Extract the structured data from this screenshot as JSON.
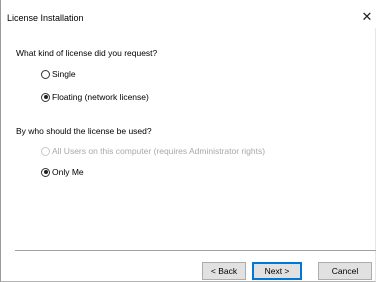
{
  "window": {
    "title": "License Installation",
    "close_glyph": "✕"
  },
  "license_type": {
    "question": "What kind of license did you request?",
    "options": [
      {
        "label": "Single",
        "selected": false,
        "enabled": true
      },
      {
        "label": "Floating (network license)",
        "selected": true,
        "enabled": true
      }
    ]
  },
  "license_scope": {
    "question": "By who should the license be used?",
    "options": [
      {
        "label": "All Users on this computer (requires Administrator rights)",
        "selected": false,
        "enabled": false
      },
      {
        "label": "Only Me",
        "selected": true,
        "enabled": true
      }
    ]
  },
  "buttons": {
    "back": "< Back",
    "next": "Next >",
    "cancel": "Cancel"
  },
  "colors": {
    "accent_focus": "#0078d7",
    "disabled_text": "#a8a8a8",
    "button_face": "#e1e1e1"
  }
}
